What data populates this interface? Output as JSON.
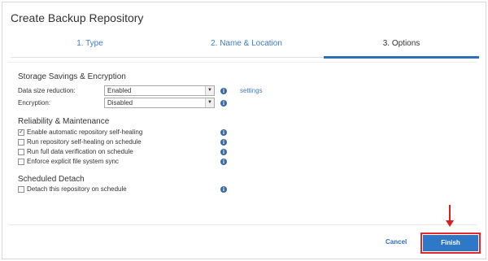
{
  "dialog": {
    "title": "Create Backup Repository"
  },
  "tabs": [
    {
      "label": "1. Type",
      "active": false
    },
    {
      "label": "2. Name & Location",
      "active": false
    },
    {
      "label": "3. Options",
      "active": true
    }
  ],
  "storage": {
    "heading": "Storage Savings & Encryption",
    "data_size_reduction": {
      "label": "Data size reduction:",
      "value": "Enabled",
      "link": "settings"
    },
    "encryption": {
      "label": "Encryption:",
      "value": "Disabled"
    }
  },
  "reliability": {
    "heading": "Reliability & Maintenance",
    "options": [
      {
        "label": "Enable automatic repository self-healing",
        "checked": true
      },
      {
        "label": "Run repository self-healing on schedule",
        "checked": false
      },
      {
        "label": "Run full data verification on schedule",
        "checked": false
      },
      {
        "label": "Enforce explicit file system sync",
        "checked": false
      }
    ]
  },
  "detach": {
    "heading": "Scheduled Detach",
    "options": [
      {
        "label": "Detach this repository on schedule",
        "checked": false
      }
    ]
  },
  "icons": {
    "info": "i",
    "dropdown": "▼",
    "check": "✓"
  },
  "footer": {
    "cancel_label": "Cancel",
    "finish_label": "Finish"
  },
  "colors": {
    "accent": "#2f78c8",
    "link": "#3b7dc4",
    "highlight": "#e8262b"
  }
}
